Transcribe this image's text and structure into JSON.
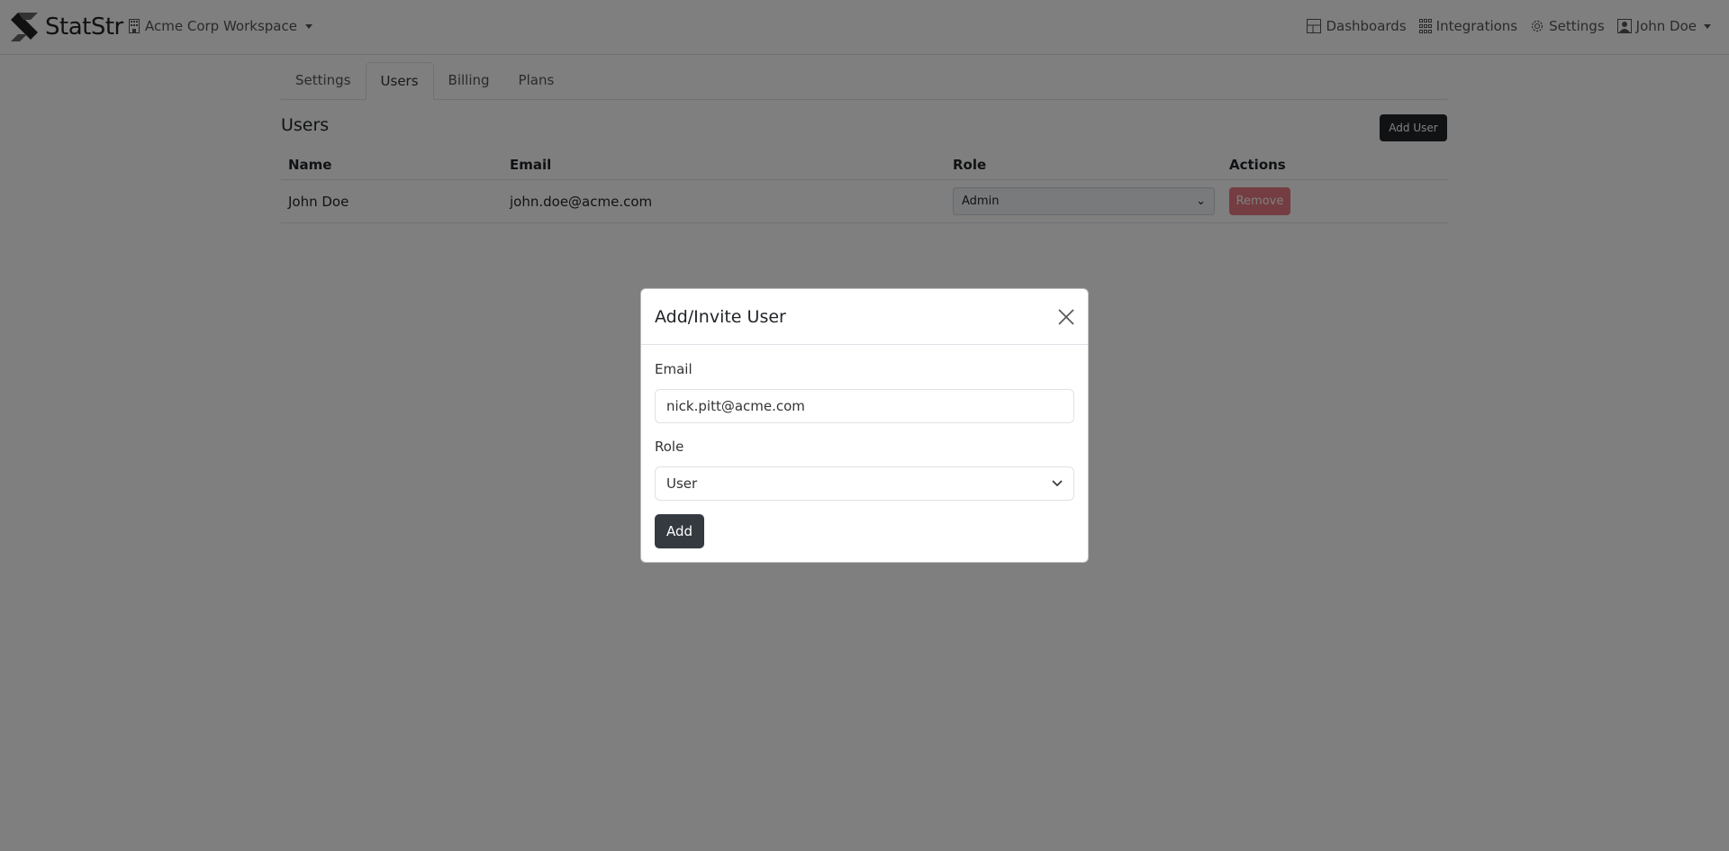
{
  "navbar": {
    "brand": "StatStr",
    "workspace": "Acme Corp Workspace",
    "links": [
      {
        "label": "Dashboards",
        "icon": "layout-icon"
      },
      {
        "label": "Integrations",
        "icon": "grid-icon"
      },
      {
        "label": "Settings",
        "icon": "gear-icon"
      }
    ],
    "user": "John Doe"
  },
  "tabs": [
    {
      "label": "Settings",
      "active": false
    },
    {
      "label": "Users",
      "active": true
    },
    {
      "label": "Billing",
      "active": false
    },
    {
      "label": "Plans",
      "active": false
    }
  ],
  "users": {
    "heading": "Users",
    "add_button": "Add User",
    "columns": [
      "Name",
      "Email",
      "Role",
      "Actions"
    ],
    "rows": [
      {
        "name": "John Doe",
        "email": "john.doe@acme.com",
        "role": "Admin",
        "action": "Remove"
      }
    ]
  },
  "modal": {
    "title": "Add/Invite User",
    "email_label": "Email",
    "email_value": "nick.pitt@acme.com",
    "role_label": "Role",
    "role_value": "User",
    "submit": "Add"
  }
}
